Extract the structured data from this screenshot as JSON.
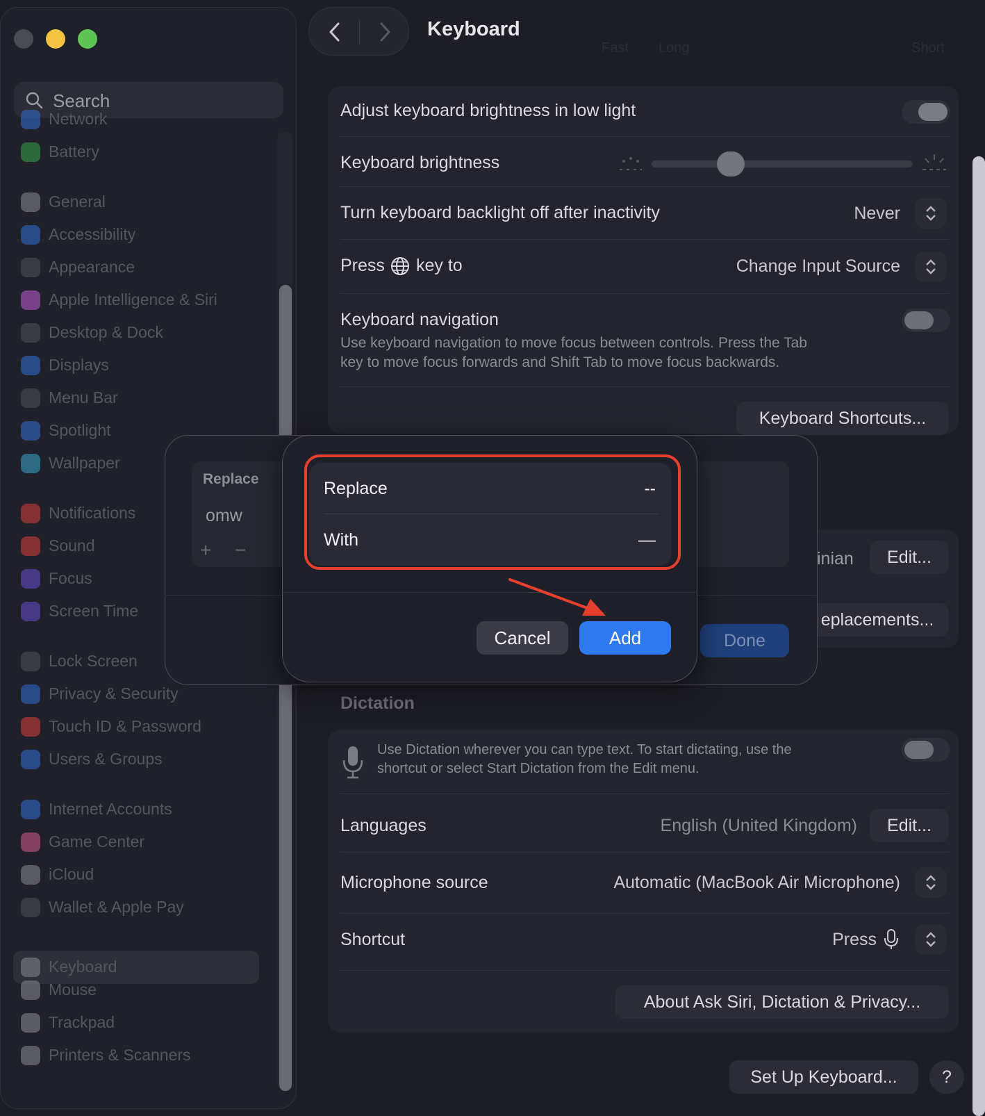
{
  "window": {
    "title": "Keyboard",
    "accent": "#2f7af0",
    "highlight_color": "#e5402f"
  },
  "sidebar": {
    "search_placeholder": "Search",
    "items": [
      {
        "label": "Network",
        "icon": "globe-icon",
        "color": "#2f6fd6"
      },
      {
        "label": "Battery",
        "icon": "battery-icon",
        "color": "#3aa64a"
      },
      {
        "label": "General",
        "icon": "gear-icon",
        "color": "#8a8a90"
      },
      {
        "label": "Accessibility",
        "icon": "accessibility-icon",
        "color": "#2f6fd6"
      },
      {
        "label": "Appearance",
        "icon": "appearance-icon",
        "color": "#505057"
      },
      {
        "label": "Apple Intelligence & Siri",
        "icon": "siri-icon",
        "color": "#c05bd6"
      },
      {
        "label": "Desktop & Dock",
        "icon": "dock-icon",
        "color": "#505057"
      },
      {
        "label": "Displays",
        "icon": "sun-icon",
        "color": "#2f6fd6"
      },
      {
        "label": "Menu Bar",
        "icon": "menu-bar-icon",
        "color": "#505057"
      },
      {
        "label": "Spotlight",
        "icon": "magnifier-icon",
        "color": "#2f6fd6"
      },
      {
        "label": "Wallpaper",
        "icon": "flower-icon",
        "color": "#38a6c8"
      },
      {
        "label": "Notifications",
        "icon": "bell-icon",
        "color": "#d6403a"
      },
      {
        "label": "Sound",
        "icon": "speaker-icon",
        "color": "#d6403a"
      },
      {
        "label": "Focus",
        "icon": "moon-icon",
        "color": "#6a4fd6"
      },
      {
        "label": "Screen Time",
        "icon": "hourglass-icon",
        "color": "#6a4fd6"
      },
      {
        "label": "Lock Screen",
        "icon": "lock-icon",
        "color": "#505057"
      },
      {
        "label": "Privacy & Security",
        "icon": "hand-icon",
        "color": "#2f6fd6"
      },
      {
        "label": "Touch ID & Password",
        "icon": "fingerprint-icon",
        "color": "#d6403a"
      },
      {
        "label": "Users & Groups",
        "icon": "users-icon",
        "color": "#2f6fd6"
      },
      {
        "label": "Internet Accounts",
        "icon": "at-icon",
        "color": "#2f6fd6"
      },
      {
        "label": "Game Center",
        "icon": "game-center-icon",
        "color": "#d65a8a"
      },
      {
        "label": "iCloud",
        "icon": "cloud-icon",
        "color": "#8a8a90"
      },
      {
        "label": "Wallet & Apple Pay",
        "icon": "wallet-icon",
        "color": "#505057"
      },
      {
        "label": "Keyboard",
        "icon": "keyboard-icon",
        "color": "#8a8a90"
      },
      {
        "label": "Mouse",
        "icon": "mouse-icon",
        "color": "#8a8a90"
      },
      {
        "label": "Trackpad",
        "icon": "trackpad-icon",
        "color": "#8a8a90"
      },
      {
        "label": "Printers & Scanners",
        "icon": "printer-icon",
        "color": "#8a8a90"
      }
    ]
  },
  "header": {
    "title": "Keyboard",
    "ghost_labels": [
      "Fast",
      "Long",
      "Short"
    ]
  },
  "settings": {
    "adjust_brightness_label": "Adjust keyboard brightness in low light",
    "brightness_label": "Keyboard brightness",
    "brightness_level": 0.3,
    "backlight_off_label": "Turn keyboard backlight off after inactivity",
    "backlight_off_value": "Never",
    "press_key_prefix": "Press",
    "press_key_suffix": "key to",
    "press_key_value": "Change Input Source",
    "nav_label": "Keyboard navigation",
    "nav_desc_1": "Use keyboard navigation to move focus between controls. Press the Tab",
    "nav_desc_2": "key to move focus forwards and Shift Tab to move focus backwards.",
    "shortcuts_button": "Keyboard Shortcuts...",
    "input_partial": "inian",
    "edit_button": "Edit...",
    "replacements_partial": "eplacements..."
  },
  "dictation": {
    "section_title": "Dictation",
    "desc_1": "Use Dictation wherever you can type text. To start dictating, use the",
    "desc_2": "shortcut or select Start Dictation from the Edit menu.",
    "languages_label": "Languages",
    "languages_value": "English (United Kingdom)",
    "languages_edit": "Edit...",
    "mic_label": "Microphone source",
    "mic_value": "Automatic (MacBook Air Microphone)",
    "shortcut_label": "Shortcut",
    "shortcut_value": "Press",
    "about_button": "About Ask Siri, Dictation & Privacy...",
    "setup_button": "Set Up Keyboard...",
    "help_button": "?"
  },
  "text_replacements_sheet": {
    "column_replace": "Replace",
    "row_value": "omw",
    "add_symbol": "+",
    "remove_symbol": "−",
    "done_button": "Done"
  },
  "add_dialog": {
    "replace_label": "Replace",
    "replace_value": "--",
    "with_label": "With",
    "with_value": "—",
    "cancel_button": "Cancel",
    "add_button": "Add"
  }
}
